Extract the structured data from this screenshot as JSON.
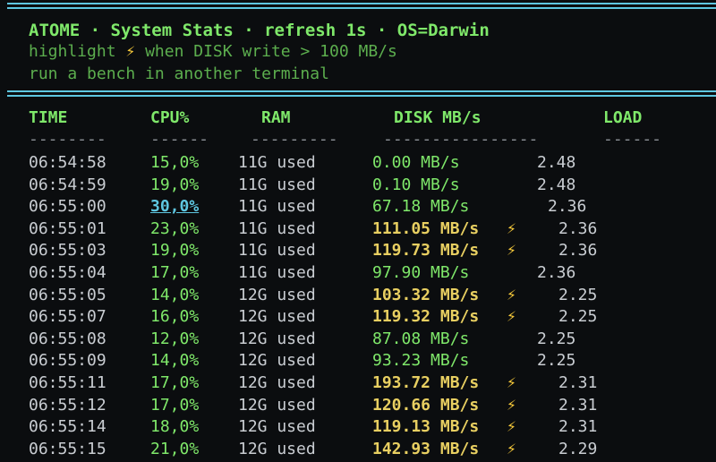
{
  "header": {
    "title": "ATOME · System Stats · refresh 1s · OS=Darwin",
    "subtitle_prefix": "highlight",
    "subtitle_suffix": "when DISK write > 100 MB/s",
    "hint": "run a bench in another terminal"
  },
  "columns": {
    "time": "TIME",
    "cpu": "CPU%",
    "ram": "RAM",
    "disk": "DISK MB/s",
    "load": "LOAD"
  },
  "dashes": {
    "time": "--------",
    "cpu": "------",
    "ram": "---------",
    "disk": "----------------",
    "load": "------"
  },
  "bolt_glyph": "⚡",
  "rows": [
    {
      "time": "06:54:58",
      "cpu": "15,0%",
      "ram": "11G used",
      "disk": "0.00 MB/s",
      "load": "2.48",
      "hot": false,
      "peak": false
    },
    {
      "time": "06:54:59",
      "cpu": "19,0%",
      "ram": "11G used",
      "disk": "0.10 MB/s",
      "load": "2.48",
      "hot": false,
      "peak": false
    },
    {
      "time": "06:55:00",
      "cpu": "30,0%",
      "ram": "11G used",
      "disk": "67.18 MB/s",
      "load": "2.36",
      "hot": false,
      "peak": true
    },
    {
      "time": "06:55:01",
      "cpu": "23,0%",
      "ram": "11G used",
      "disk": "111.05 MB/s",
      "load": "2.36",
      "hot": true,
      "peak": false
    },
    {
      "time": "06:55:03",
      "cpu": "19,0%",
      "ram": "11G used",
      "disk": "119.73 MB/s",
      "load": "2.36",
      "hot": true,
      "peak": false
    },
    {
      "time": "06:55:04",
      "cpu": "17,0%",
      "ram": "11G used",
      "disk": "97.90 MB/s",
      "load": "2.36",
      "hot": false,
      "peak": false
    },
    {
      "time": "06:55:05",
      "cpu": "14,0%",
      "ram": "12G used",
      "disk": "103.32 MB/s",
      "load": "2.25",
      "hot": true,
      "peak": false
    },
    {
      "time": "06:55:07",
      "cpu": "16,0%",
      "ram": "12G used",
      "disk": "119.32 MB/s",
      "load": "2.25",
      "hot": true,
      "peak": false
    },
    {
      "time": "06:55:08",
      "cpu": "12,0%",
      "ram": "12G used",
      "disk": "87.08 MB/s",
      "load": "2.25",
      "hot": false,
      "peak": false
    },
    {
      "time": "06:55:09",
      "cpu": "14,0%",
      "ram": "12G used",
      "disk": "93.23 MB/s",
      "load": "2.25",
      "hot": false,
      "peak": false
    },
    {
      "time": "06:55:11",
      "cpu": "17,0%",
      "ram": "12G used",
      "disk": "193.72 MB/s",
      "load": "2.31",
      "hot": true,
      "peak": false
    },
    {
      "time": "06:55:12",
      "cpu": "17,0%",
      "ram": "12G used",
      "disk": "120.66 MB/s",
      "load": "2.31",
      "hot": true,
      "peak": false
    },
    {
      "time": "06:55:14",
      "cpu": "18,0%",
      "ram": "12G used",
      "disk": "119.13 MB/s",
      "load": "2.31",
      "hot": true,
      "peak": false
    },
    {
      "time": "06:55:15",
      "cpu": "21,0%",
      "ram": "12G used",
      "disk": "142.93 MB/s",
      "load": "2.29",
      "hot": true,
      "peak": false
    }
  ],
  "colors": {
    "background": "#0b0d0f",
    "accent_green": "#7fe86a",
    "dim_green": "#5cae4e",
    "rule_cyan": "#5ec6e0",
    "hot_yellow": "#e8cf61",
    "bolt": "#f5c83a",
    "text": "#c9cdd2"
  }
}
